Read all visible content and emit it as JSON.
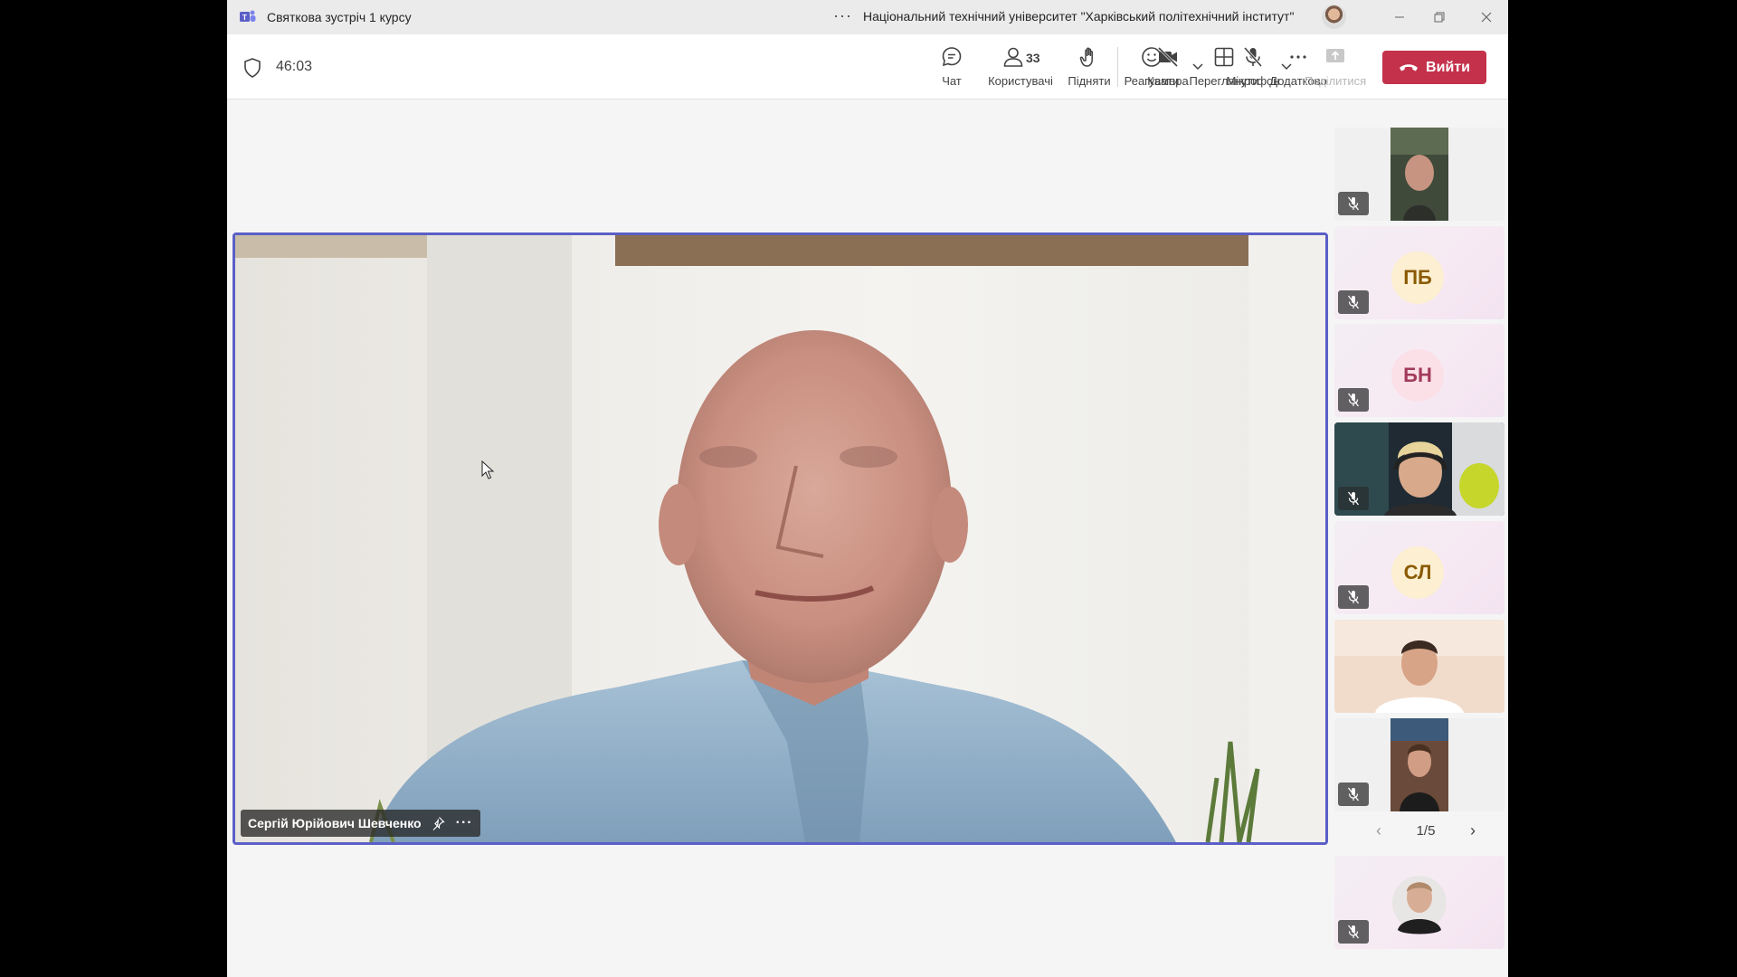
{
  "window": {
    "title": "Святкова зустріч 1 курсу",
    "more_label": "···",
    "organization": "Національний технічний університет \"Харківський політехнічний інститут\""
  },
  "toolbar": {
    "timer": "46:03",
    "chat_label": "Чат",
    "people_label": "Користувачі",
    "people_count": "33",
    "raise_label": "Підняти",
    "react_label": "Реагувати",
    "view_label": "Переглянути",
    "more_label": "Додатково",
    "camera_label": "Камера",
    "mic_label": "Мікрофон",
    "share_label": "Поділитися",
    "leave_label": "Вийти"
  },
  "stage": {
    "speaker_name": "Сергій Юрійович Шевченко",
    "more_dots": "···"
  },
  "gallery": {
    "tiles": [
      {
        "type": "video"
      },
      {
        "type": "initials",
        "initials": "ПБ"
      },
      {
        "type": "initials",
        "initials": "БН"
      },
      {
        "type": "video"
      },
      {
        "type": "initials",
        "initials": "СЛ"
      },
      {
        "type": "video"
      },
      {
        "type": "video"
      }
    ],
    "pager": "1/5",
    "self_view": {
      "type": "video"
    }
  },
  "colors": {
    "accent": "#5b5fc7",
    "leave": "#c4314b",
    "initials_pb_bg": "#fcefd2",
    "initials_pb_fg": "#8a5a00",
    "initials_bn_bg": "#fbe0e8",
    "initials_bn_fg": "#a23a5b",
    "initials_sl_bg": "#fcefd2",
    "initials_sl_fg": "#8a5a00"
  }
}
